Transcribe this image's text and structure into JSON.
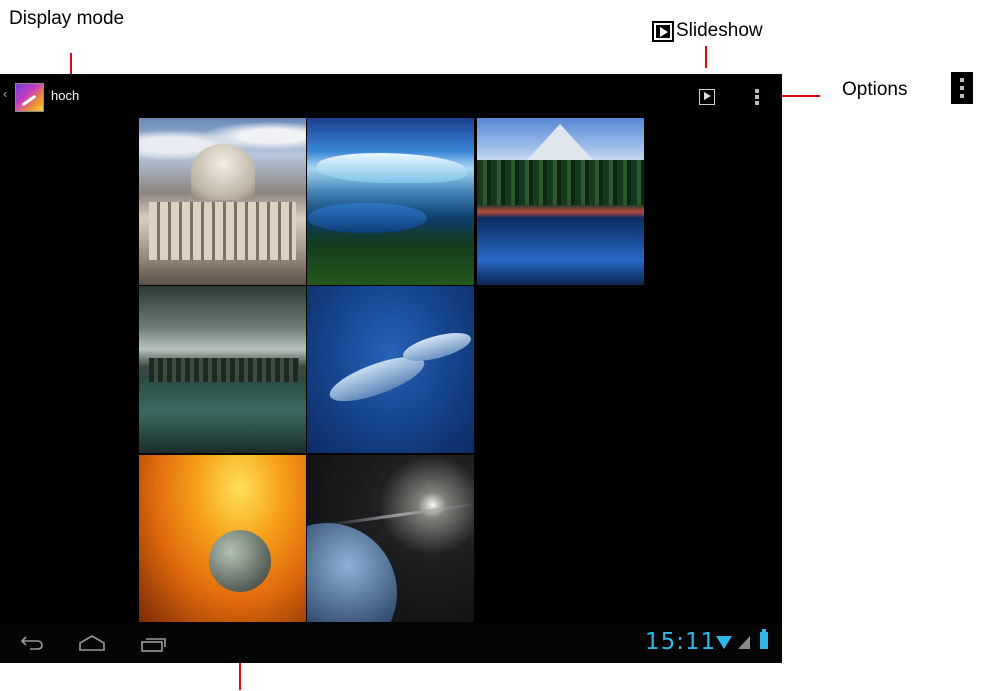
{
  "annotations": {
    "display_mode": "Display mode",
    "slideshow": "Slideshow",
    "options": "Options"
  },
  "action_bar": {
    "album_title": "hoch",
    "icons": [
      "up-caret-icon",
      "app-icon",
      "slideshow-icon",
      "overflow-menu-icon"
    ]
  },
  "thumbnails": [
    {
      "subject": "capitol-building"
    },
    {
      "subject": "glacier-landscape"
    },
    {
      "subject": "mountain-lake-reflection"
    },
    {
      "subject": "tropical-coast"
    },
    {
      "subject": "fish-underwater"
    },
    {
      "subject": "sun-and-planet"
    },
    {
      "subject": "planet-in-space"
    }
  ],
  "nav_bar": {
    "clock": "15:11",
    "icons": [
      "back-icon",
      "home-icon",
      "recents-icon",
      "wifi-icon",
      "signal-icon",
      "battery-icon"
    ]
  },
  "colors": {
    "leader_lines": "#e30613",
    "status_accent": "#33b5e5",
    "screen_background": "#000000"
  }
}
